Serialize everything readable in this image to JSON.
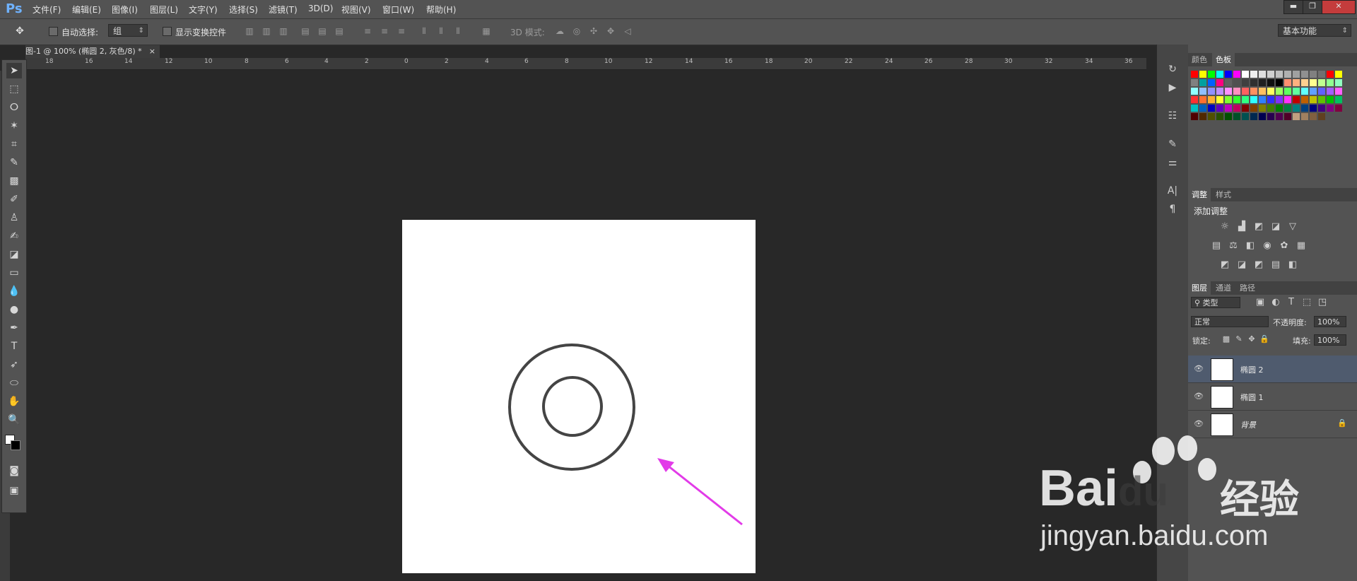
{
  "app": {
    "logo": "Ps"
  },
  "menu": [
    "文件(F)",
    "编辑(E)",
    "图像(I)",
    "图层(L)",
    "文字(Y)",
    "选择(S)",
    "滤镜(T)",
    "3D(D)",
    "视图(V)",
    "窗口(W)",
    "帮助(H)"
  ],
  "window_controls": [
    "▬",
    "❐",
    "✕"
  ],
  "options": {
    "auto_select_label": "自动选择:",
    "auto_select_value": "组",
    "show_transform_label": "显示变换控件",
    "mode3d_label": "3D 模式:",
    "workspace": "基本功能"
  },
  "document": {
    "tab_title": "图-1 @ 100% (椭圆 2, 灰色/8) *",
    "tab_close": "×"
  },
  "ruler_h": [
    "18",
    "16",
    "14",
    "12",
    "10",
    "8",
    "6",
    "4",
    "2",
    "0",
    "2",
    "4",
    "6",
    "8",
    "10",
    "12",
    "14",
    "16",
    "18",
    "20",
    "22",
    "24",
    "26",
    "28",
    "30",
    "32",
    "34",
    "36"
  ],
  "panels": {
    "color_tab": "颜色",
    "swatches_tab": "色板",
    "adjust_tab": "调整",
    "styles_tab": "样式",
    "add_adjustment": "添加调整",
    "layers_tab": "图层",
    "channels_tab": "通道",
    "paths_tab": "路径",
    "filter_kind": "类型",
    "blend_mode": "正常",
    "opacity_label": "不透明度:",
    "opacity_value": "100%",
    "lock_label": "锁定:",
    "fill_label": "填充:",
    "fill_value": "100%",
    "layers": [
      {
        "name": "椭圆 2",
        "selected": true
      },
      {
        "name": "椭圆 1",
        "selected": false
      },
      {
        "name": "背景",
        "selected": false
      }
    ]
  },
  "watermark": {
    "brand": "Bai",
    "brand2": "du",
    "cn": "经验",
    "url": "jingyan.baidu.com"
  },
  "colors": {
    "accent": "#e23be8",
    "layer_selected": "#4f5b6e",
    "ring": "#444444"
  }
}
